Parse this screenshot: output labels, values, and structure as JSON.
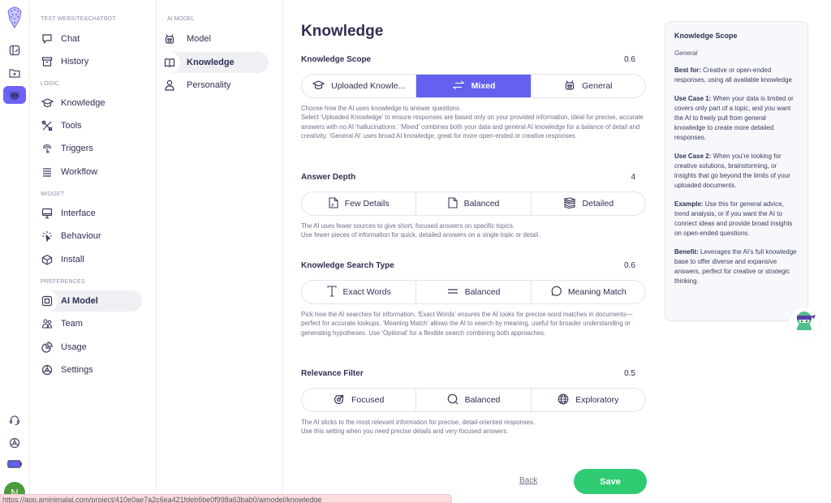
{
  "rail": {
    "icons": [
      "logo-icon",
      "dashboard-icon",
      "add-folder-icon",
      "bot-icon"
    ],
    "bottom_icons": [
      "support-icon",
      "settings-wheel-icon",
      "battery-icon"
    ],
    "avatar_initial": "N"
  },
  "nav": {
    "sections": [
      {
        "title": "TEST WEBSITE&CHATBOT",
        "items": [
          {
            "label": "Chat",
            "icon": "chat-icon"
          },
          {
            "label": "History",
            "icon": "archive-icon"
          }
        ]
      },
      {
        "title": "LOGIC",
        "items": [
          {
            "label": "Knowledge",
            "icon": "graduation-cap-icon"
          },
          {
            "label": "Tools",
            "icon": "tools-icon"
          },
          {
            "label": "Triggers",
            "icon": "trigger-icon"
          },
          {
            "label": "Workflow",
            "icon": "workflow-icon"
          }
        ]
      },
      {
        "title": "WIDGET",
        "items": [
          {
            "label": "Interface",
            "icon": "monitor-icon"
          },
          {
            "label": "Behaviour",
            "icon": "cursor-click-icon"
          },
          {
            "label": "Install",
            "icon": "box-icon"
          }
        ]
      },
      {
        "title": "PREFERENCES",
        "items": [
          {
            "label": "AI Model",
            "icon": "chip-icon",
            "active": true
          },
          {
            "label": "Team",
            "icon": "team-icon"
          },
          {
            "label": "Usage",
            "icon": "pie-chart-icon"
          },
          {
            "label": "Settings",
            "icon": "settings-icon"
          }
        ]
      }
    ]
  },
  "subnav": {
    "title": "AI MODEL",
    "items": [
      {
        "label": "Model",
        "icon": "robot-icon"
      },
      {
        "label": "Knowledge",
        "icon": "book-icon",
        "active": true
      },
      {
        "label": "Personality",
        "icon": "person-icon"
      }
    ]
  },
  "main": {
    "title": "Knowledge",
    "settings": [
      {
        "label": "Knowledge Scope",
        "value": "0.6",
        "options": [
          {
            "label": "Uploaded Knowle...",
            "icon": "graduation-cap-icon"
          },
          {
            "label": "Mixed",
            "icon": "arrows-exchange-icon",
            "selected": true
          },
          {
            "label": "General",
            "icon": "robot-icon"
          }
        ],
        "description": "Choose how the AI uses knowledge to answer questions.\nSelect ‘Uploaded Knowledge’ to ensure responses are based only on your provided information, ideal for precise, accurate answers with no AI ‘hallucinations.’ ‘Mixed’ combines both your data and general AI knowledge for a balance of detail and creativity. ‘General AI’ uses broad AI knowledge, great for more open-ended or creative responses."
      },
      {
        "label": "Answer Depth",
        "value": "4",
        "options": [
          {
            "label": "Few Details",
            "icon": "document-icon"
          },
          {
            "label": "Balanced",
            "icon": "file-icon"
          },
          {
            "label": "Detailed",
            "icon": "stack-books-icon"
          }
        ],
        "description": "The AI uses fewer sources to give short, focused answers on specific topics.\nUse fewer pieces of information for quick, detailed answers on a single topic or detail."
      },
      {
        "label": "Knowledge Search Type",
        "value": "0.6",
        "options": [
          {
            "label": "Exact Words",
            "icon": "text-icon"
          },
          {
            "label": "Balanced",
            "icon": "equals-icon"
          },
          {
            "label": "Meaning Match",
            "icon": "speech-bubble-icon"
          }
        ],
        "description": "Pick how the AI searches for information. ‘Exact Words’ ensures the AI looks for precise word matches in documents—perfect for accurate lookups. ‘Meaning Match’ allows the AI to search by meaning, useful for broader understanding or generating hypotheses. Use ‘Optional’ for a flexible search combining both approaches."
      },
      {
        "label": "Relevance Filter",
        "value": "0.5",
        "options": [
          {
            "label": "Focused",
            "icon": "target-icon"
          },
          {
            "label": "Balanced",
            "icon": "search-icon"
          },
          {
            "label": "Exploratory",
            "icon": "globe-icon"
          }
        ],
        "description": "The AI sticks to the most relevant information for precise, detail-oriented responses.\nUse this setting when you need precise details and very focused answers."
      }
    ],
    "back_label": "Back",
    "save_label": "Save"
  },
  "info_panel": {
    "title": "Knowledge Scope",
    "subtitle": "General",
    "blocks": [
      {
        "label": "Best for:",
        "text": " Creative or open-ended responses, using all available knowledge"
      },
      {
        "label": "Use Case 1:",
        "text": " When your data is limited or covers only part of a topic, and you want the AI to freely pull from general knowledge to create more detailed responses."
      },
      {
        "label": "Use Case 2:",
        "text": " When you’re looking for creative solutions, brainstorming, or insights that go beyond the limits of your uploaded documents."
      },
      {
        "label": "Example:",
        "text": " Use this for general advice, trend analysis, or if you want the AI to connect ideas and provide broad insights on open-ended questions."
      },
      {
        "label": "Benefit:",
        "text": " Leverages the AI’s full knowledge base to offer diverse and expansive answers, perfect for creative or strategic thinking."
      }
    ]
  },
  "statusbar": {
    "text": "https://app.aminimalai.com/project/410e0ae7a2c6ea421fdeb6be0f998a63bab0/aimodel/knowledge"
  },
  "colors": {
    "accent": "#6460f0",
    "save": "#2fcb73",
    "avatar": "#4d9a3d"
  }
}
